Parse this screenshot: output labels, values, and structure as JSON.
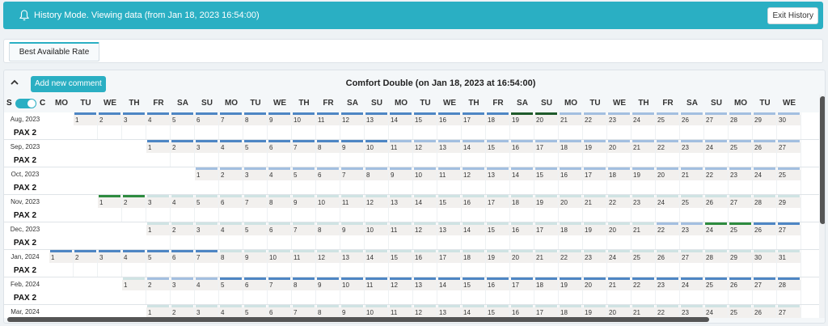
{
  "banner": {
    "text": "History Mode. Viewing data (from Jan 18, 2023 16:54:00)",
    "exit_label": "Exit History"
  },
  "tabs": [
    {
      "label": "Best Available Rate"
    }
  ],
  "panel": {
    "add_comment_label": "Add new comment",
    "title": "Comfort Double (on Jan 18, 2023 at 16:54:00)"
  },
  "toggle": {
    "left": "S",
    "right": "C"
  },
  "weekdays": [
    "MO",
    "TU",
    "WE",
    "TH",
    "FR",
    "SA",
    "SU",
    "MO",
    "TU",
    "WE",
    "TH",
    "FR",
    "SA",
    "SU",
    "MO",
    "TU",
    "WE",
    "TH",
    "FR",
    "SA",
    "SU",
    "MO",
    "TU",
    "WE",
    "TH",
    "FR",
    "SA",
    "SU",
    "MO",
    "TU",
    "WE",
    "TH"
  ],
  "pax_label": "PAX 2",
  "colors": {
    "accent": "#2aafc3",
    "bar_blue": "#4e86c4",
    "bar_lightblue": "#a3bfe0",
    "bar_green": "#2e8b3f",
    "bar_darkgreen": "#1e5a2a",
    "bar_pale": "#cfe3e3"
  },
  "months": [
    {
      "label": "Aug, 2023",
      "start": 1,
      "days": 31,
      "bars": [
        "blue",
        "blue",
        "blue",
        "blue",
        "blue",
        "blue",
        "blue",
        "blue",
        "blue",
        "blue",
        "blue",
        "blue",
        "blue",
        "blue",
        "blue",
        "blue",
        "blue",
        "blue",
        "darkgreen",
        "darkgreen",
        "lightblue",
        "lightblue",
        "lightblue",
        "lightblue",
        "lightblue",
        "lightblue",
        "lightblue",
        "lightblue",
        "lightblue",
        "lightblue",
        "lightblue"
      ]
    },
    {
      "label": "Sep, 2023",
      "start": 4,
      "days": 28,
      "bars": [
        "blue",
        "blue",
        "blue",
        "blue",
        "blue",
        "blue",
        "blue",
        "blue",
        "blue",
        "blue",
        "lightblue",
        "lightblue",
        "lightblue",
        "lightblue",
        "lightblue",
        "lightblue",
        "lightblue",
        "lightblue",
        "lightblue",
        "lightblue",
        "lightblue",
        "lightblue",
        "lightblue",
        "lightblue",
        "lightblue",
        "lightblue",
        "lightblue",
        "lightblue"
      ]
    },
    {
      "label": "Oct, 2023",
      "start": 6,
      "days": 26,
      "bars": [
        "lightblue",
        "lightblue",
        "lightblue",
        "lightblue",
        "lightblue",
        "lightblue",
        "lightblue",
        "lightblue",
        "lightblue",
        "lightblue",
        "lightblue",
        "lightblue",
        "lightblue",
        "lightblue",
        "lightblue",
        "lightblue",
        "lightblue",
        "lightblue",
        "lightblue",
        "lightblue",
        "lightblue",
        "lightblue",
        "lightblue",
        "lightblue",
        "lightblue",
        "lightblue"
      ]
    },
    {
      "label": "Nov, 2023",
      "start": 2,
      "days": 30,
      "bars": [
        "green",
        "green",
        "pale",
        "pale",
        "pale",
        "pale",
        "pale",
        "pale",
        "pale",
        "pale",
        "pale",
        "pale",
        "pale",
        "pale",
        "pale",
        "pale",
        "pale",
        "pale",
        "pale",
        "pale",
        "pale",
        "pale",
        "pale",
        "pale",
        "pale",
        "pale",
        "pale",
        "pale",
        "pale",
        "lightblue"
      ]
    },
    {
      "label": "Dec, 2023",
      "start": 4,
      "days": 28,
      "bars": [
        "pale",
        "pale",
        "pale",
        "pale",
        "pale",
        "pale",
        "pale",
        "pale",
        "pale",
        "pale",
        "pale",
        "pale",
        "pale",
        "pale",
        "pale",
        "pale",
        "pale",
        "pale",
        "pale",
        "pale",
        "pale",
        "lightblue",
        "lightblue",
        "green",
        "green",
        "blue",
        "blue",
        "lightblue"
      ]
    },
    {
      "label": "Jan, 2024",
      "start": 0,
      "days": 31,
      "bars": [
        "blue",
        "blue",
        "blue",
        "blue",
        "blue",
        "blue",
        "blue",
        "pale",
        "pale",
        "pale",
        "pale",
        "pale",
        "pale",
        "pale",
        "pale",
        "pale",
        "pale",
        "pale",
        "pale",
        "pale",
        "pale",
        "pale",
        "pale",
        "pale",
        "pale",
        "pale",
        "pale",
        "pale",
        "pale",
        "pale",
        "pale"
      ]
    },
    {
      "label": "Feb, 2024",
      "start": 3,
      "days": 29,
      "bars": [
        "pale",
        "lightblue",
        "lightblue",
        "lightblue",
        "blue",
        "blue",
        "blue",
        "blue",
        "blue",
        "blue",
        "blue",
        "blue",
        "blue",
        "blue",
        "blue",
        "blue",
        "blue",
        "blue",
        "blue",
        "blue",
        "blue",
        "blue",
        "blue",
        "blue",
        "blue",
        "blue",
        "blue",
        "blue",
        "blue"
      ]
    },
    {
      "label": "Mar, 2024",
      "start": 4,
      "days": 28,
      "bars": [
        "pale",
        "pale",
        "pale",
        "pale",
        "pale",
        "pale",
        "pale",
        "pale",
        "pale",
        "pale",
        "pale",
        "pale",
        "pale",
        "pale",
        "pale",
        "pale",
        "pale",
        "pale",
        "pale",
        "pale",
        "pale",
        "pale",
        "pale",
        "pale",
        "pale",
        "pale",
        "pale",
        "pale"
      ]
    }
  ]
}
